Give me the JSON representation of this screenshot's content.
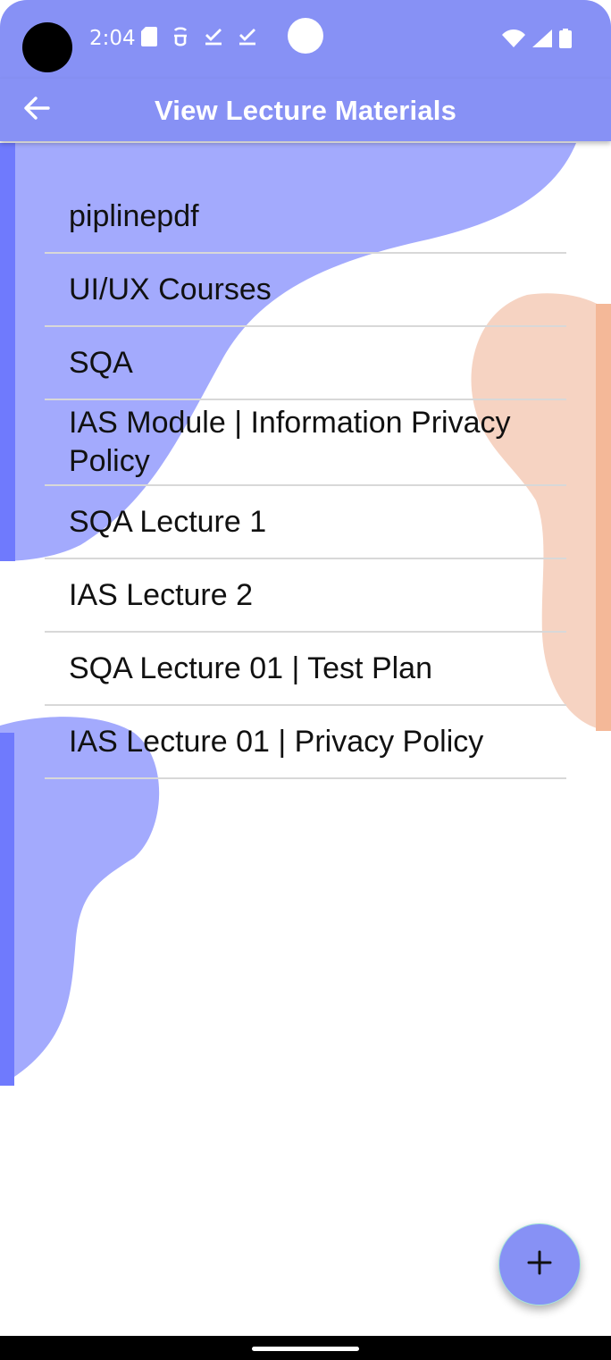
{
  "status_bar": {
    "time": "2:04",
    "left_icons": [
      "sd-card-icon",
      "security-icon",
      "check-icon",
      "check-icon"
    ],
    "right_icons": [
      "wifi-icon",
      "signal-icon",
      "battery-icon"
    ]
  },
  "app_bar": {
    "title": "View Lecture Materials",
    "back_icon": "arrow-back-icon"
  },
  "materials": [
    "piplinepdf",
    "UI/UX Courses",
    "SQA",
    "IAS Module | Information Privacy Policy",
    "SQA Lecture 1",
    "IAS Lecture 2",
    "SQA Lecture 01 | Test Plan",
    "IAS Lecture 01 | Privacy Policy"
  ],
  "fab": {
    "icon": "plus-icon"
  },
  "colors": {
    "primary": "#8791f5",
    "blob_blue": "#a3aafd",
    "blob_blue_edge": "#6f7afd",
    "blob_peach": "#f6d3c2",
    "blob_peach_edge": "#f4b898"
  }
}
